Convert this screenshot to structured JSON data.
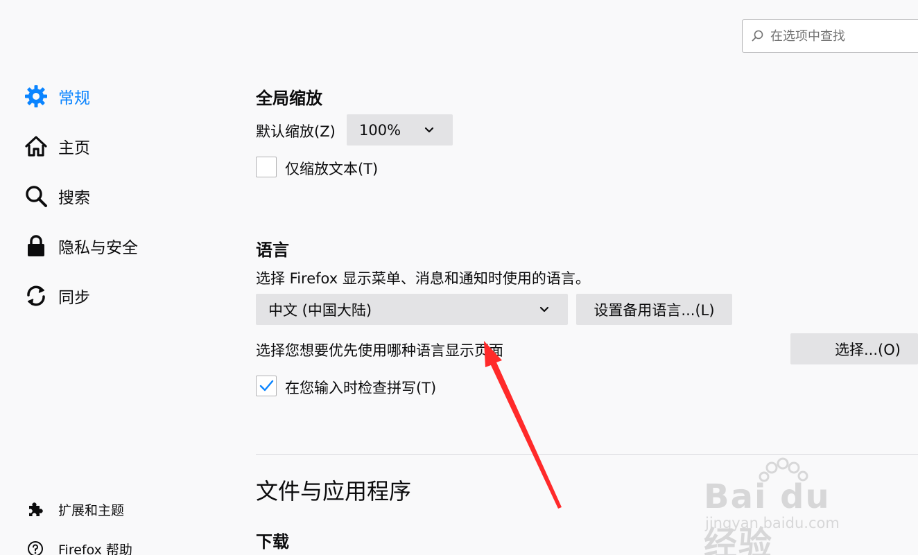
{
  "search": {
    "placeholder": "在选项中查找"
  },
  "sidebar": {
    "items": [
      {
        "label": "常规",
        "icon": "gear-icon",
        "active": true
      },
      {
        "label": "主页",
        "icon": "home-icon"
      },
      {
        "label": "搜索",
        "icon": "search-icon"
      },
      {
        "label": "隐私与安全",
        "icon": "lock-icon"
      },
      {
        "label": "同步",
        "icon": "sync-icon"
      }
    ],
    "footer": [
      {
        "label": "扩展和主题",
        "icon": "puzzle-icon"
      },
      {
        "label": "Firefox 帮助",
        "icon": "help-icon"
      }
    ]
  },
  "zoom": {
    "title": "全局缩放",
    "default_label": "默认缩放(Z)",
    "default_value": "100%",
    "text_only_label": "仅缩放文本(T)",
    "text_only_checked": false
  },
  "language": {
    "title": "语言",
    "description": "选择 Firefox 显示菜单、消息和通知时使用的语言。",
    "selected": "中文 (中国大陆)",
    "alternate_button": "设置备用语言...(L)",
    "page_lang_label": "选择您想要优先使用哪种语言显示页面",
    "choose_button": "选择...(O)",
    "spellcheck_label": "在您输入时检查拼写(T)",
    "spellcheck_checked": true
  },
  "files": {
    "section_title": "文件与应用程序",
    "downloads_title": "下载"
  },
  "watermark": {
    "brand": "Bai du 经验",
    "url": "jingyan.baidu.com"
  },
  "colors": {
    "accent": "#0a84ff",
    "annotation": "#ff2a2a"
  }
}
